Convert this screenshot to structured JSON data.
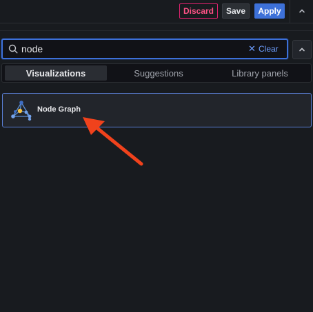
{
  "toolbar": {
    "discard_label": "Discard",
    "save_label": "Save",
    "apply_label": "Apply",
    "collapse_icon": "chevron-up-icon"
  },
  "search": {
    "value": "node",
    "placeholder": "",
    "icon": "search-icon",
    "clear_label": "Clear",
    "clear_icon": "close-icon"
  },
  "tabs": [
    {
      "label": "Visualizations",
      "active": true
    },
    {
      "label": "Suggestions",
      "active": false
    },
    {
      "label": "Library panels",
      "active": false
    }
  ],
  "results": [
    {
      "name": "Node Graph",
      "icon": "node-graph-icon",
      "selected": true
    }
  ],
  "colors": {
    "accent": "#3d71d9",
    "discard": "#e0226e",
    "annotation_arrow": "#f0421c"
  }
}
